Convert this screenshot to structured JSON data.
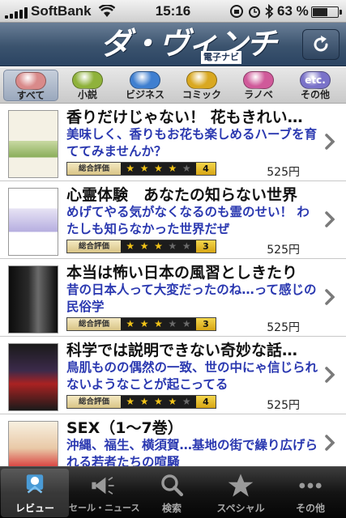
{
  "status_bar": {
    "carrier": "SoftBank",
    "time": "15:16",
    "battery_pct": "63 %",
    "battery_level": 0.63
  },
  "header": {
    "logo": "ダ・ヴィンチ",
    "logo_sub": "電子ナビ",
    "refresh_icon": "refresh-icon"
  },
  "categories": [
    {
      "label": "すべて",
      "icon": "all-icon",
      "color": "#d98a8a",
      "active": true
    },
    {
      "label": "小説",
      "icon": "book-icon",
      "color": "#8fb23b",
      "active": false
    },
    {
      "label": "ビジネス",
      "icon": "info-icon",
      "color": "#3f7fd0",
      "active": false
    },
    {
      "label": "コミック",
      "icon": "star-icon",
      "color": "#d9a820",
      "active": false
    },
    {
      "label": "ラノベ",
      "icon": "tag-icon",
      "color": "#d05a9a",
      "active": false
    },
    {
      "label": "その他",
      "icon": "etc-icon",
      "icon_text": "etc.",
      "color": "#7a72c9",
      "active": false
    }
  ],
  "rating_label": "総合評価",
  "items": [
    {
      "title": "香りだけじゃない！ 花もきれい…",
      "desc": "美味しく、香りもお花も楽しめるハーブを育ててみませんか？",
      "rating": 4,
      "price": "525円"
    },
    {
      "title": "心霊体験　あなたの知らない世界",
      "desc": "めげてやる気がなくなるのも霊のせい！ わたしも知らなかった世界だぜ",
      "rating": 3,
      "price": "525円"
    },
    {
      "title": "本当は怖い日本の風習としきたり",
      "desc": "昔の日本人って大変だったのね…って感じの民俗学",
      "rating": 3,
      "price": "525円"
    },
    {
      "title": "科学では説明できない奇妙な話…",
      "desc": "鳥肌ものの偶然の一致、世の中にゃ信じられないようなことが起こってる",
      "rating": 4,
      "price": "525円"
    },
    {
      "title": "SEX（1〜7巻）",
      "desc": "沖縄、福生、横須賀…基地の街で繰り広げられる若者たちの喧騒",
      "rating": 0,
      "price": ""
    }
  ],
  "tabs": [
    {
      "label": "レビュー",
      "icon": "review-icon",
      "active": true
    },
    {
      "label": "セール・ニュース",
      "icon": "megaphone-icon",
      "active": false
    },
    {
      "label": "検索",
      "icon": "search-icon",
      "active": false
    },
    {
      "label": "スペシャル",
      "icon": "star-icon",
      "active": false
    },
    {
      "label": "その他",
      "icon": "more-icon",
      "active": false
    }
  ]
}
